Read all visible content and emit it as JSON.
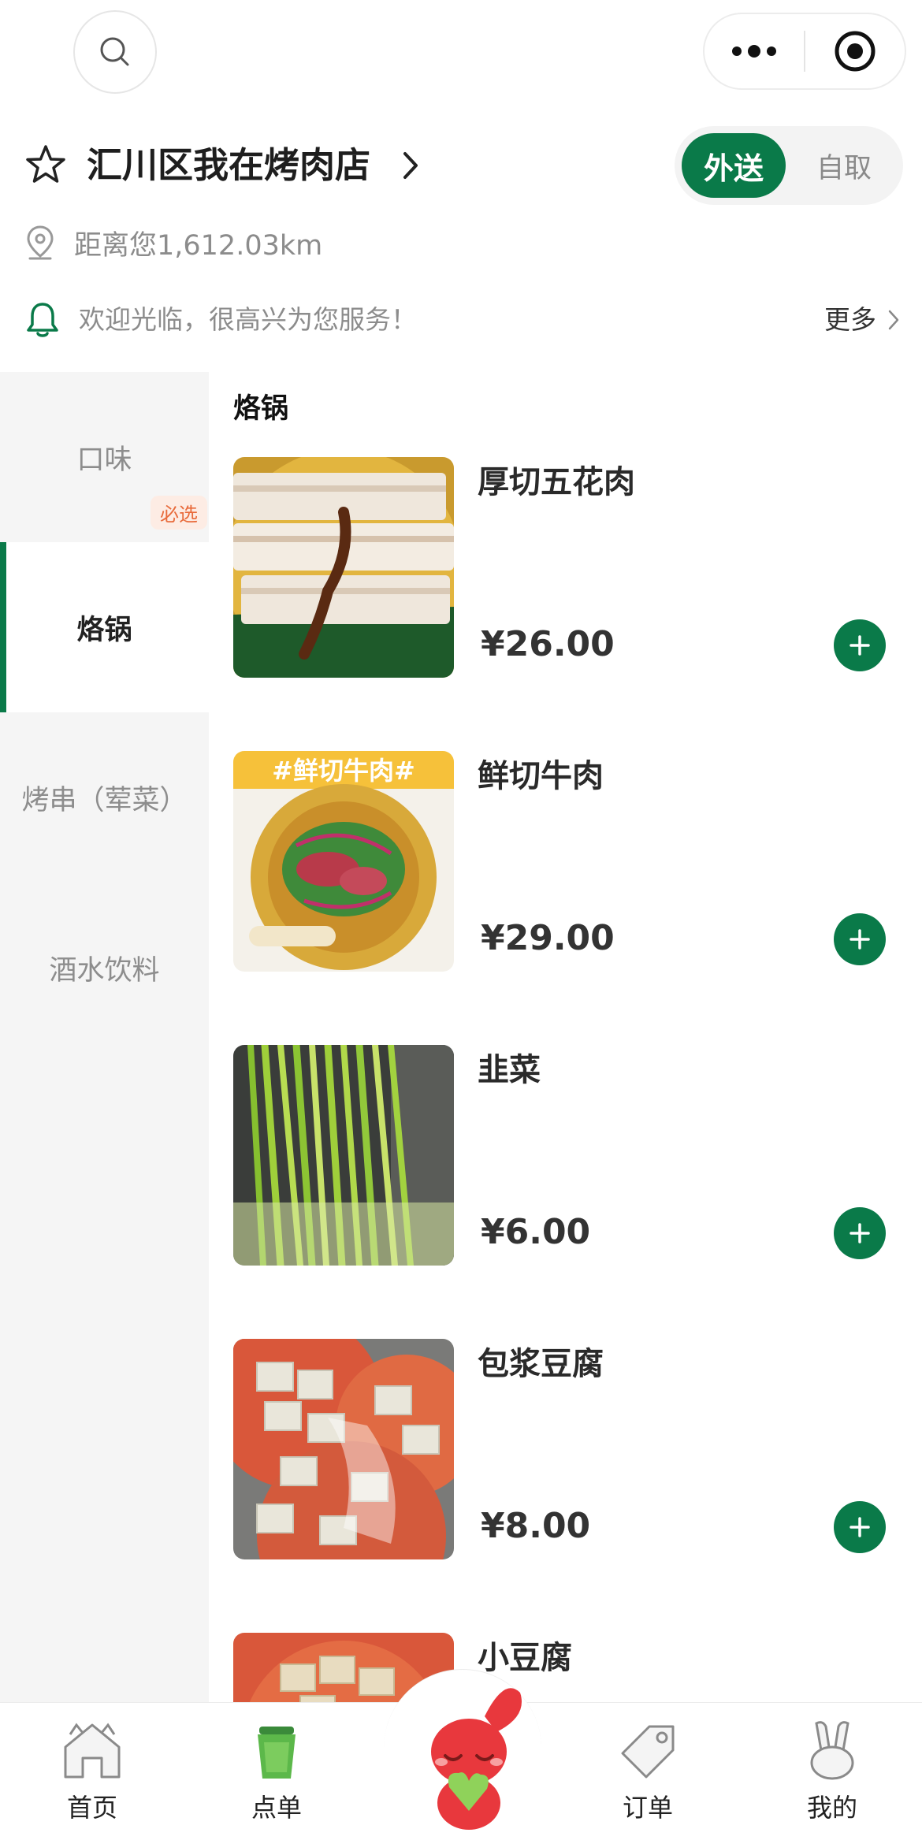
{
  "header": {
    "search_icon": "search-icon",
    "capsule_menu_icon": "more-dots-icon",
    "capsule_close_icon": "target-icon"
  },
  "shop": {
    "name": "汇川区我在烤肉店",
    "distance": "距离您1,612.03km",
    "notice": "欢迎光临，很高兴为您服务！",
    "more_label": "更多",
    "modes": {
      "active": "外送",
      "inactive": "自取"
    }
  },
  "categories": [
    {
      "label": "口味",
      "badge": "必选"
    },
    {
      "label": "烙锅"
    },
    {
      "label": "烤串（荤菜）"
    },
    {
      "label": "酒水饮料"
    }
  ],
  "menu": {
    "section_title": "烙锅",
    "products": [
      {
        "name": "厚切五花肉",
        "price": "¥26.00",
        "image_icon": "pork-belly-photo"
      },
      {
        "name": "鲜切牛肉",
        "price": "¥29.00",
        "image_icon": "beef-salad-photo",
        "image_text": "#鲜切牛肉#"
      },
      {
        "name": "韭菜",
        "price": "¥6.00",
        "image_icon": "chives-photo"
      },
      {
        "name": "包浆豆腐",
        "price": "¥8.00",
        "image_icon": "tofu-photo"
      },
      {
        "name": "小豆腐",
        "price": "",
        "image_icon": "small-tofu-photo"
      }
    ]
  },
  "tabbar": [
    {
      "label": "首页",
      "icon": "home-icon"
    },
    {
      "label": "点单",
      "icon": "cup-icon"
    },
    {
      "label": "",
      "icon": "mascot-icon"
    },
    {
      "label": "订单",
      "icon": "tag-icon"
    },
    {
      "label": "我的",
      "icon": "rabbit-icon"
    }
  ],
  "colors": {
    "brand_green": "#0a7a49",
    "badge_orange": "#e86a3a",
    "sidebar_bg": "#f5f5f5",
    "mascot_red": "#e8383d"
  }
}
